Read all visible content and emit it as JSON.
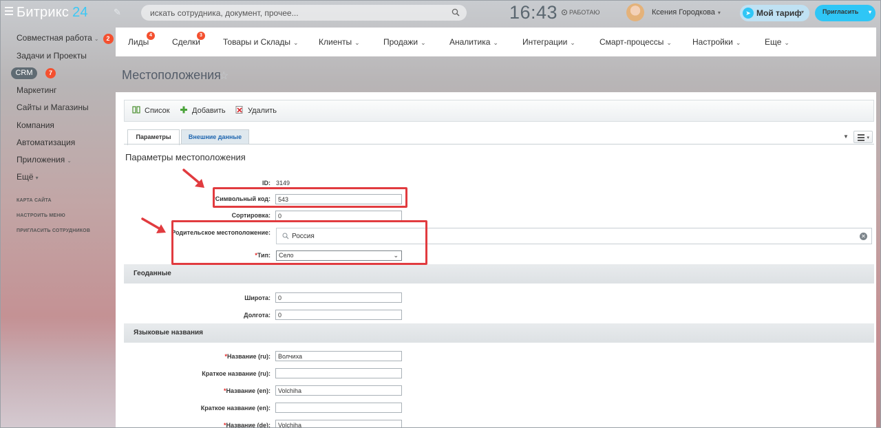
{
  "header": {
    "logo_main": "Битрикс",
    "logo_num": "24",
    "search_placeholder": "искать сотрудника, документ, прочее...",
    "clock": "16:43",
    "work_status": "РАБОТАЮ",
    "user_name": "Ксения Городкова",
    "tariff_label": "Мой тариф",
    "invite_label": "Пригласить"
  },
  "sidebar": {
    "items": [
      {
        "label": "Совместная работа",
        "badge": "2"
      },
      {
        "label": "Задачи и Проекты"
      },
      {
        "label": "CRM",
        "badge": "7"
      },
      {
        "label": "Маркетинг"
      },
      {
        "label": "Сайты и Магазины"
      },
      {
        "label": "Компания"
      },
      {
        "label": "Автоматизация"
      },
      {
        "label": "Приложения"
      },
      {
        "label": "Ещё"
      }
    ],
    "small_links": [
      "КАРТА САЙТА",
      "НАСТРОИТЬ МЕНЮ",
      "ПРИГЛАСИТЬ СОТРУДНИКОВ"
    ]
  },
  "topnav": {
    "items": [
      {
        "label": "Лиды",
        "badge": "4"
      },
      {
        "label": "Сделки",
        "badge": "3"
      },
      {
        "label": "Товары и Склады"
      },
      {
        "label": "Клиенты"
      },
      {
        "label": "Продажи"
      },
      {
        "label": "Аналитика"
      },
      {
        "label": "Интеграции"
      },
      {
        "label": "Смарт-процессы"
      },
      {
        "label": "Настройки"
      },
      {
        "label": "Еще"
      }
    ]
  },
  "page": {
    "title": "Местоположения",
    "toolbar": {
      "list": "Список",
      "add": "Добавить",
      "delete": "Удалить"
    },
    "tabs": [
      "Параметры",
      "Внешние данные"
    ],
    "section_title": "Параметры местоположения"
  },
  "form": {
    "id_label": "ID:",
    "id_value": "3149",
    "code_label": "Символьный код:",
    "code_value": "543",
    "sort_label": "Сортировка:",
    "sort_value": "0",
    "parent_label": "Родительское местоположение:",
    "parent_value": "Россия",
    "type_label": "Тип:",
    "type_value": "Село",
    "geo_header": "Геоданные",
    "lat_label": "Широта:",
    "lat_value": "0",
    "lon_label": "Долгота:",
    "lon_value": "0",
    "lang_header": "Языковые названия",
    "name_ru_label": "Название (ru):",
    "name_ru_value": "Волчиха",
    "short_ru_label": "Краткое название (ru):",
    "short_ru_value": "",
    "name_en_label": "Название (en):",
    "name_en_value": "Volchiha",
    "short_en_label": "Краткое название (en):",
    "short_en_value": "",
    "name_de_label": "Название (de):",
    "name_de_value": "Volchiha",
    "required_mark": "*"
  },
  "colors": {
    "accent": "#2fc6f6",
    "badge": "#f4502f",
    "highlight": "#e13b3f"
  }
}
